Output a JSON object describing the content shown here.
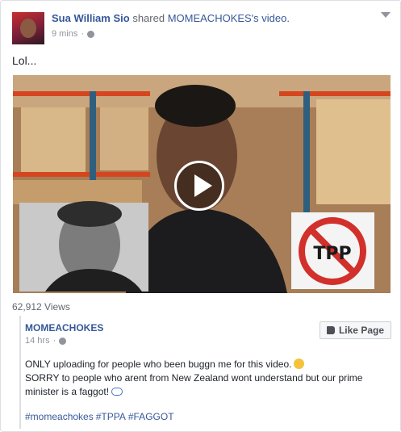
{
  "post": {
    "author": "Sua William Sio",
    "verb": "shared",
    "shared_item": "MOMEACHOKES's video.",
    "time": "9 mins",
    "text": "Lol..."
  },
  "video": {
    "sign_text": "TPP",
    "views": "62,912 Views"
  },
  "shared_post": {
    "page_name": "MOMEACHOKES",
    "time": "14 hrs",
    "like_button": "Like Page",
    "line1": "ONLY uploading for people who been buggn me for this video.",
    "line2": "SORRY to people who arent from New Zealand wont understand but our prime minister is a faggot!",
    "hashtags": [
      "#momeachokes",
      "#TPPA",
      "#FAGGOT"
    ]
  }
}
